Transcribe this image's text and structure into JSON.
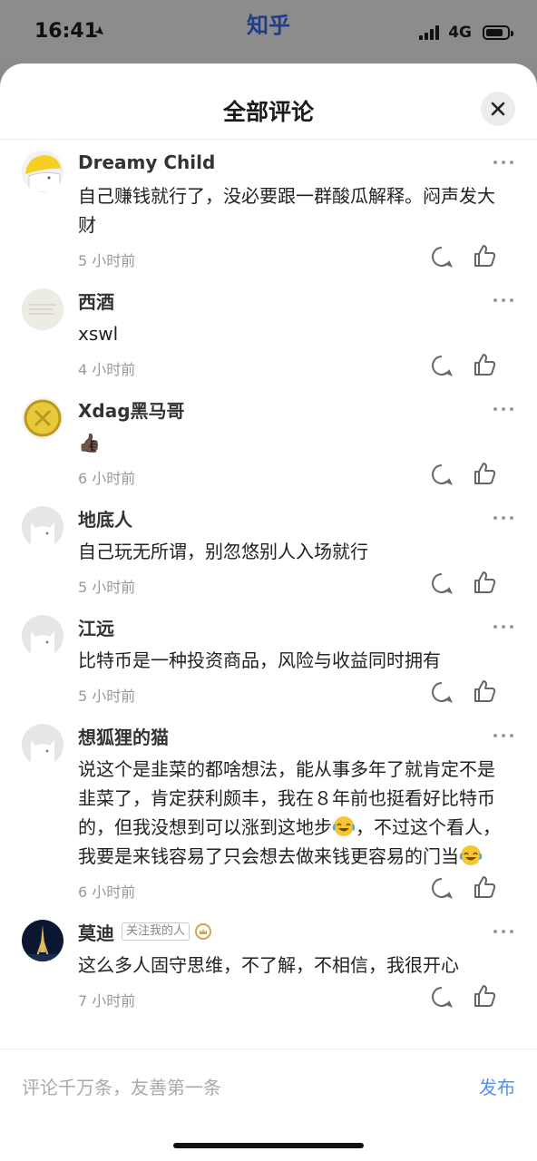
{
  "status_bar": {
    "time": "16:41",
    "app_name": "知乎",
    "network": "4G"
  },
  "sheet": {
    "title": "全部评论"
  },
  "comments": [
    {
      "author": "Dreamy Child",
      "text": "自己赚钱就行了，没必要跟一群酸瓜解释。闷声发大财",
      "time": "5 小时前",
      "avatar": "yellow-helmet-avatar"
    },
    {
      "author": "西酒",
      "text": "xswl",
      "time": "4 小时前",
      "avatar": "paper-avatar"
    },
    {
      "author": "Xdag黑马哥",
      "text": "👍🏿",
      "time": "6 小时前",
      "avatar": "gold-coin-avatar"
    },
    {
      "author": "地底人",
      "text": "自己玩无所谓，别忽悠别人入场就行",
      "time": "5 小时前",
      "avatar": "default-cat-avatar"
    },
    {
      "author": "江远",
      "text": "比特币是一种投资商品，风险与收益同时拥有",
      "time": "5 小时前",
      "avatar": "default-cat-avatar"
    },
    {
      "author": "想狐狸的猫",
      "text_part1": "说这个是韭菜的都啥想法，能从事多年了就肯定不是韭菜了，肯定获利颇丰，我在８年前也挺看好比特币的，但我没想到可以涨到这地步",
      "text_part2": "，不过这个看人，我要是来钱容易了只会想去做来钱更容易的门当",
      "time": "6 小时前",
      "avatar": "default-cat-avatar",
      "emoji": "laugh-cry-emoji"
    },
    {
      "author": "莫迪",
      "badge": "关注我的人",
      "text": "这么多人固守思维，不了解，不相信，我很开心",
      "time": "7 小时前",
      "avatar": "eiffel-night-avatar"
    }
  ],
  "input_bar": {
    "placeholder": "评论千万条，友善第一条",
    "publish_label": "发布"
  },
  "colors": {
    "app_title": "#1f3c8f",
    "publish": "#5b8fe3",
    "overlay": "#8c8c8c"
  }
}
